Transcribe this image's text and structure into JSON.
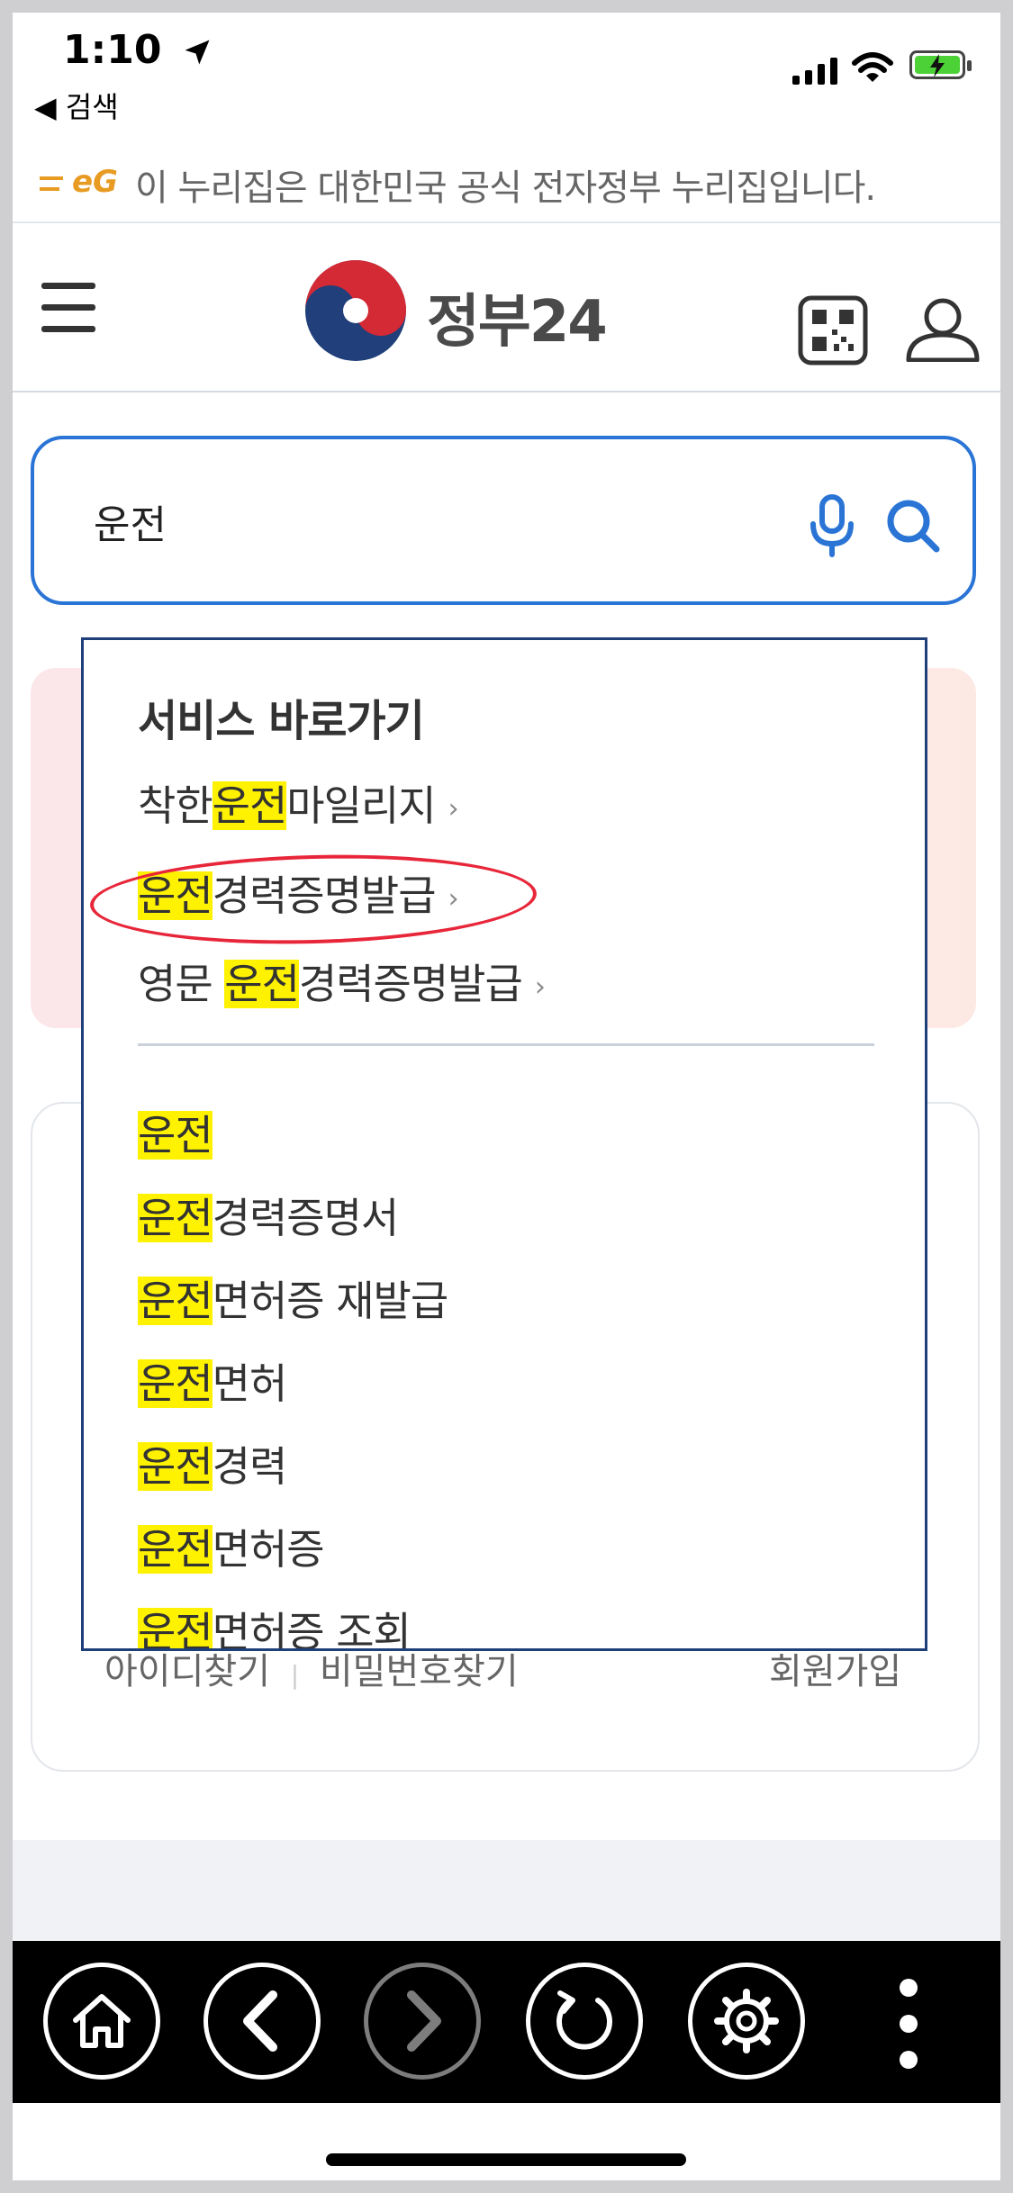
{
  "status_bar": {
    "time": "1:10",
    "back_label": "◀ 검색"
  },
  "egov_notice": {
    "logo": "eG",
    "text": "이 누리집은 대한민국 공식 전자정부 누리집입니다."
  },
  "header": {
    "logo_text": "정부24"
  },
  "search": {
    "value": "운전"
  },
  "background": {
    "find_id": "아이디찾기",
    "separator": "|",
    "find_password": "비밀번호찾기",
    "join": "회원가입"
  },
  "dropdown": {
    "section_title": "서비스 바로가기",
    "shortcuts": [
      {
        "prefix": "착한",
        "match": "운전",
        "suffix": "마일리지",
        "chevron": "›"
      },
      {
        "prefix": "",
        "match": "운전",
        "suffix": "경력증명발급",
        "chevron": "›",
        "circled": true
      },
      {
        "prefix": "영문 ",
        "match": "운전",
        "suffix": "경력증명발급",
        "chevron": "›"
      }
    ],
    "suggestions": [
      {
        "match": "운전",
        "suffix": ""
      },
      {
        "match": "운전",
        "suffix": "경력증명서"
      },
      {
        "match": "운전",
        "suffix": "면허증 재발급"
      },
      {
        "match": "운전",
        "suffix": "면허"
      },
      {
        "match": "운전",
        "suffix": "경력"
      },
      {
        "match": "운전",
        "suffix": "면허증"
      },
      {
        "match": "운전",
        "suffix": "면허증 조회"
      }
    ]
  },
  "icons": {
    "location": "location-arrow-icon",
    "signal": "signal-bars-icon",
    "wifi": "wifi-icon",
    "battery": "battery-charging-icon",
    "menu": "hamburger-menu-icon",
    "emblem": "taegeuk-emblem-icon",
    "qr": "qr-code-icon",
    "user": "user-icon",
    "mic": "microphone-icon",
    "search": "search-icon",
    "home": "home-icon",
    "back": "chevron-left-icon",
    "forward": "chevron-right-icon",
    "reload": "reload-icon",
    "settings": "gear-icon",
    "more": "more-vertical-icon"
  },
  "colors": {
    "accent_blue": "#2a74d6",
    "highlight": "#fff200",
    "annotation_red": "#e8263a",
    "dropdown_border": "#1f3f7a"
  }
}
